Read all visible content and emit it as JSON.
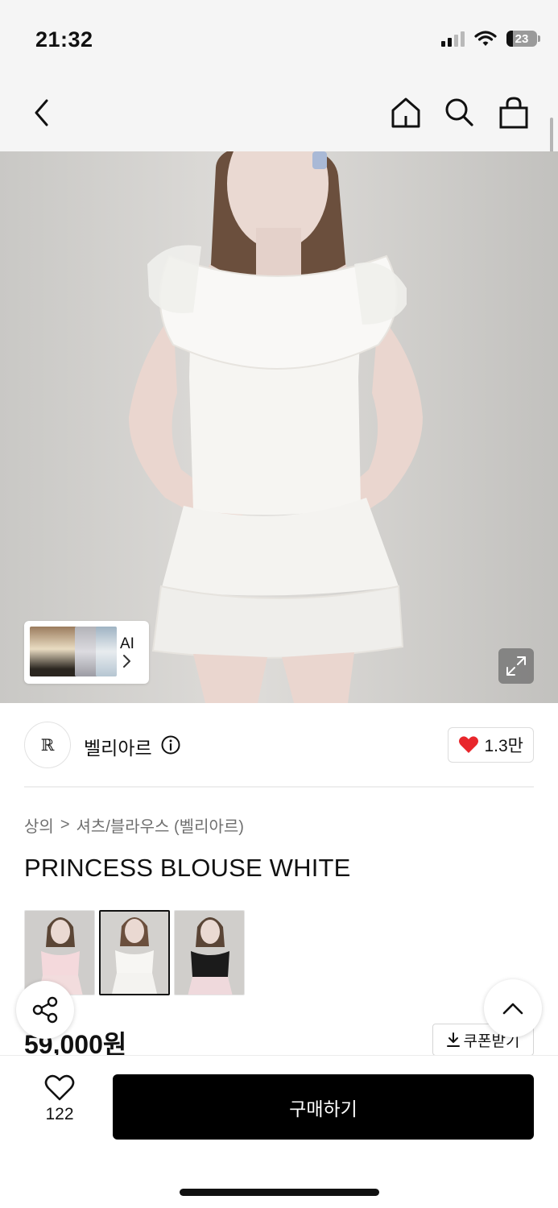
{
  "status_bar": {
    "time": "21:32",
    "battery": "23"
  },
  "nav": {
    "back_icon": "chevron-left-icon",
    "home_icon": "home-icon",
    "search_icon": "search-icon",
    "cart_icon": "shopping-bag-icon"
  },
  "hero": {
    "ai_label": "AI",
    "colors": {
      "top_white": "#f6f5f2",
      "hair": "#6b4f3d",
      "skin": "#ead9d2"
    }
  },
  "brand": {
    "name": "벨리아르",
    "logo_text": "ℝ",
    "likes": "1.3만",
    "heart_color": "#e8262b"
  },
  "breadcrumb": {
    "level1": "상의",
    "separator": ">",
    "level2": "셔츠/블라우스 (벨리아르)"
  },
  "product": {
    "title": "PRINCESS BLOUSE WHITE",
    "price": "59,000원",
    "coupon_label": "쿠폰받기",
    "variants": [
      {
        "name": "pink",
        "top_color": "#f4d9dc",
        "skirt_color": "#f2dcdd"
      },
      {
        "name": "white",
        "top_color": "#f7f6f3",
        "skirt_color": "#f4f3f0"
      },
      {
        "name": "black",
        "top_color": "#1b1b1b",
        "skirt_color": "#efd9dc"
      }
    ]
  },
  "bottom": {
    "wish_count": "122",
    "buy_label": "구매하기"
  }
}
